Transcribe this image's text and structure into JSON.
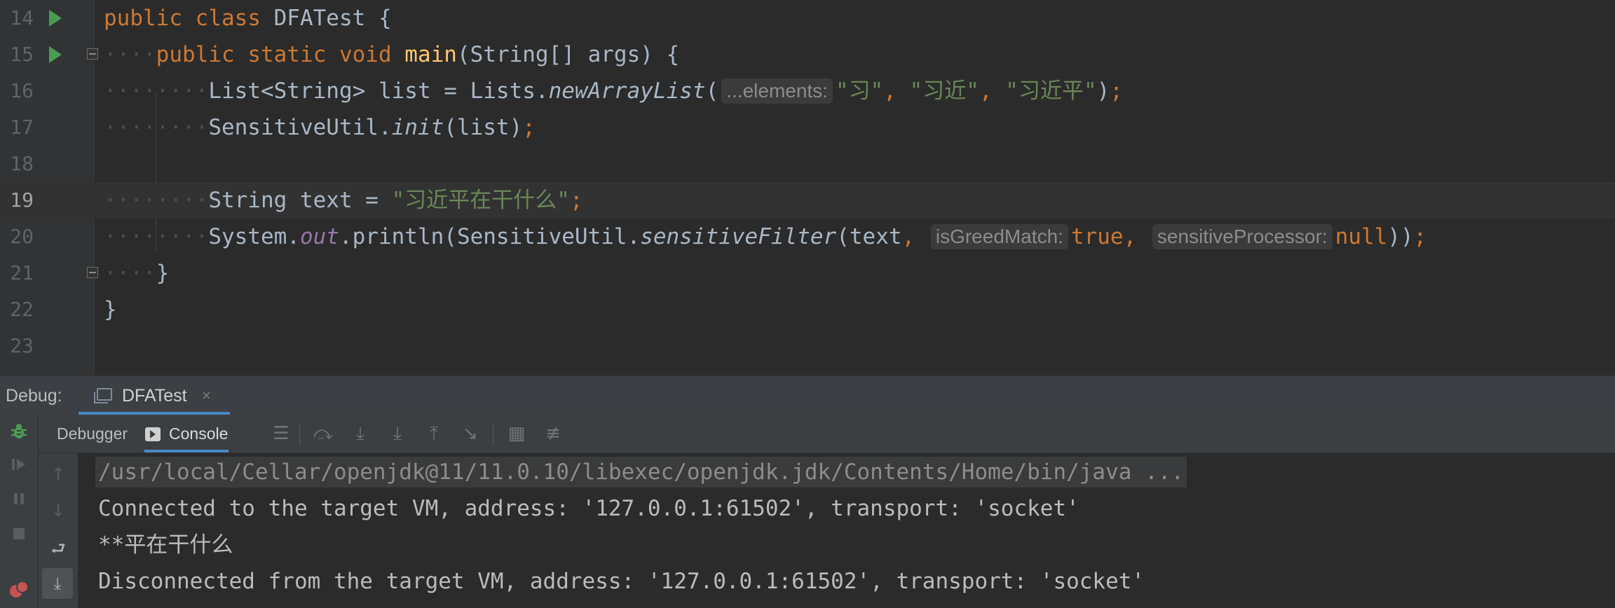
{
  "editor": {
    "lines": [
      {
        "n": "14",
        "run": true,
        "fold": false,
        "current": false,
        "guide": "",
        "tokens": [
          [
            "kw",
            "public "
          ],
          [
            "kw",
            "class "
          ],
          [
            "txt",
            "DFATest "
          ],
          [
            "txt",
            "{"
          ]
        ]
      },
      {
        "n": "15",
        "run": true,
        "fold": true,
        "current": false,
        "guide": "····",
        "tokens": [
          [
            "kw",
            "public "
          ],
          [
            "kw",
            "static "
          ],
          [
            "kw",
            "void "
          ],
          [
            "mth",
            "main"
          ],
          [
            "txt",
            "(String[] "
          ],
          [
            "txt",
            "args) "
          ],
          [
            "txt",
            "{"
          ]
        ]
      },
      {
        "n": "16",
        "run": false,
        "fold": false,
        "current": false,
        "guide": "········",
        "tokens": [
          [
            "txt",
            "List<String> "
          ],
          [
            "txt",
            "list "
          ],
          [
            "txt",
            "= "
          ],
          [
            "txt",
            "Lists."
          ],
          [
            "it",
            "newArrayList"
          ],
          [
            "txt",
            "("
          ],
          [
            "hint",
            "...elements:"
          ],
          [
            "str",
            "\"习\""
          ],
          [
            "kw",
            ", "
          ],
          [
            "str",
            "\"习近\""
          ],
          [
            "kw",
            ", "
          ],
          [
            "str",
            "\"习近平\""
          ],
          [
            "txt",
            ")"
          ],
          [
            "kw",
            ";"
          ]
        ]
      },
      {
        "n": "17",
        "run": false,
        "fold": false,
        "current": false,
        "guide": "········",
        "tokens": [
          [
            "txt",
            "SensitiveUtil."
          ],
          [
            "it",
            "init"
          ],
          [
            "txt",
            "(list)"
          ],
          [
            "kw",
            ";"
          ]
        ]
      },
      {
        "n": "18",
        "run": false,
        "fold": false,
        "current": false,
        "guide": "",
        "tokens": []
      },
      {
        "n": "19",
        "run": false,
        "fold": false,
        "current": true,
        "guide": "········",
        "tokens": [
          [
            "txt",
            "String "
          ],
          [
            "txt",
            "text "
          ],
          [
            "txt",
            "= "
          ],
          [
            "str",
            "\"习近平在干什么\""
          ],
          [
            "kw",
            ";"
          ]
        ]
      },
      {
        "n": "20",
        "run": false,
        "fold": false,
        "current": false,
        "guide": "········",
        "tokens": [
          [
            "txt",
            "System."
          ],
          [
            "fld",
            "out"
          ],
          [
            "txt",
            ".println(SensitiveUtil."
          ],
          [
            "it",
            "sensitiveFilter"
          ],
          [
            "txt",
            "(text"
          ],
          [
            "kw",
            ", "
          ],
          [
            "hint",
            "isGreedMatch:"
          ],
          [
            "kw",
            "true"
          ],
          [
            "kw",
            ", "
          ],
          [
            "hint",
            "sensitiveProcessor:"
          ],
          [
            "kw",
            "null"
          ],
          [
            "txt",
            "))"
          ],
          [
            "kw",
            ";"
          ]
        ]
      },
      {
        "n": "21",
        "run": false,
        "fold": true,
        "current": false,
        "guide": "····",
        "tokens": [
          [
            "txt",
            "}"
          ]
        ]
      },
      {
        "n": "22",
        "run": false,
        "fold": false,
        "current": false,
        "guide": "",
        "tokens": [
          [
            "txt",
            "}"
          ]
        ]
      },
      {
        "n": "23",
        "run": false,
        "fold": false,
        "current": false,
        "guide": "",
        "tokens": []
      }
    ]
  },
  "debug": {
    "label": "Debug:",
    "run_tab": {
      "label": "DFATest",
      "close": "×"
    },
    "tabs": {
      "debugger": "Debugger",
      "console": "Console"
    }
  },
  "console": {
    "lines": [
      "/usr/local/Cellar/openjdk@11/11.0.10/libexec/openjdk.jdk/Contents/Home/bin/java ...",
      "Connected to the target VM, address: '127.0.0.1:61502', transport: 'socket'",
      "**平在干什么",
      "Disconnected from the target VM, address: '127.0.0.1:61502', transport: 'socket'"
    ]
  },
  "colors": {
    "keyword": "#cc7832",
    "string": "#6a8759",
    "method": "#ffc66d",
    "field": "#9876aa",
    "text": "#a9b7c6",
    "accent": "#4a88c7",
    "run": "#499c54"
  },
  "icons": {
    "editor_gutter": [
      "run-icon",
      "fold-icon"
    ],
    "debug_toolbar": [
      "threads-icon",
      "step-over-icon",
      "step-into-icon",
      "force-step-into-icon",
      "step-out-icon",
      "run-to-cursor-icon",
      "evaluate-icon",
      "trace-icon"
    ],
    "debug_side": [
      "debug-bug-icon",
      "resume-icon",
      "pause-icon",
      "stop-icon",
      "breakpoints-icon"
    ],
    "console_side": [
      "up-arrow-icon",
      "down-arrow-icon",
      "soft-wrap-icon",
      "scroll-to-end-icon"
    ]
  }
}
